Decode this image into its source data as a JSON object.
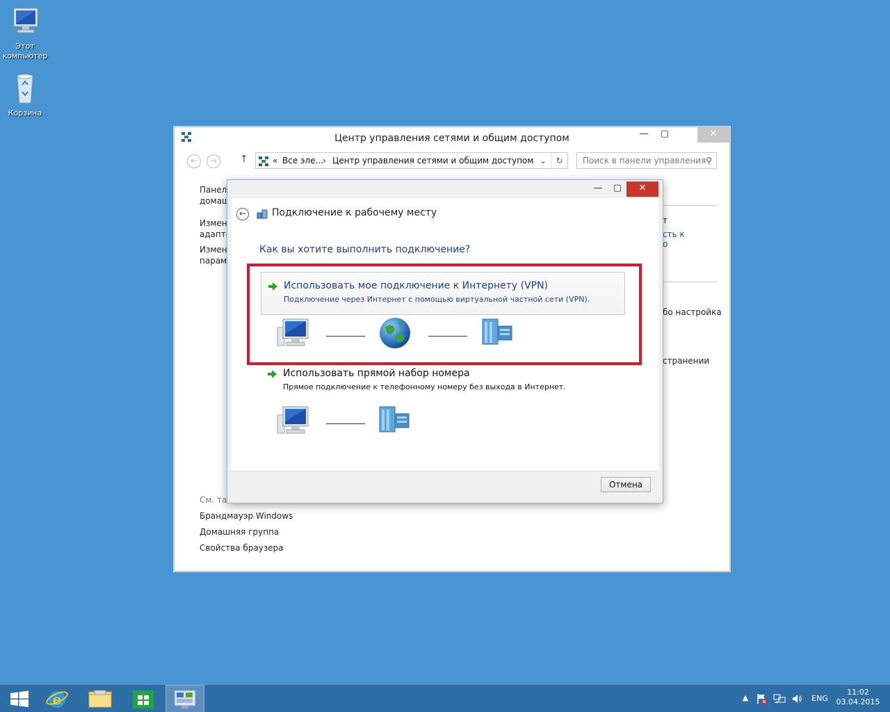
{
  "desktop": {
    "icons": [
      {
        "label_line1": "Этот",
        "label_line2": "компьютер",
        "icon": "computer-icon"
      },
      {
        "label_line1": "Корзина",
        "label_line2": "",
        "icon": "recycle-bin-icon"
      }
    ]
  },
  "main_window": {
    "title": "Центр управления сетями и общим доступом",
    "breadcrumb": {
      "prefix": "«",
      "item1": "Все эле...",
      "sep": "›",
      "item2": "Центр управления сетями и общим доступом"
    },
    "search_placeholder": "Поиск в панели управления",
    "sidebar_partial": [
      {
        "line1": "Панель",
        "line2": "домаш"
      },
      {
        "line1": "Измене",
        "line2": "адаптер"
      },
      {
        "line1": "Измени",
        "line2": "парамет"
      }
    ],
    "right_partial": [
      {
        "text": "т"
      },
      {
        "text": "сть к"
      },
      {
        "text": "о"
      },
      {
        "text": "бо настройка"
      },
      {
        "text": "странении"
      }
    ],
    "see_also_partial": "См. так",
    "see_also_links": [
      "Брандмауэр Windows",
      "Домашняя группа",
      "Свойства браузера"
    ]
  },
  "dialog": {
    "title": "Подключение к рабочему месту",
    "question": "Как вы хотите выполнить подключение?",
    "options": [
      {
        "title": "Использовать мое подключение к Интернету (VPN)",
        "description": "Подключение через Интернет с помощью виртуальной частной сети (VPN)."
      },
      {
        "title": "Использовать прямой набор номера",
        "description": "Прямое подключение к телефонному номеру без выхода в Интернет."
      }
    ],
    "cancel_label": "Отмена"
  },
  "taskbar": {
    "language": "ENG",
    "time": "11:02",
    "date": "03.04.2015"
  },
  "colors": {
    "desktop": "#4796d3",
    "link_blue": "#1e3f87",
    "highlight_red": "#e0142d",
    "taskbar": "#2e6ea7"
  }
}
